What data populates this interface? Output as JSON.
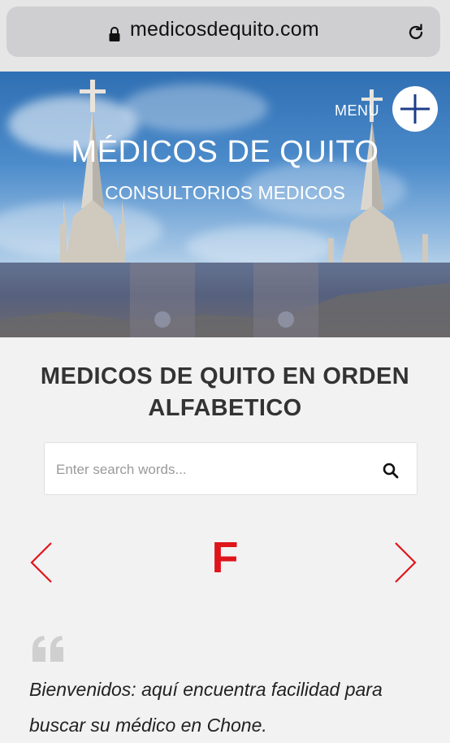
{
  "browser": {
    "url": "medicosdequito.com",
    "lock_icon": "lock-icon",
    "reload_icon": "reload-icon"
  },
  "header": {
    "title": "MÉDICOS DE QUITO",
    "subtitle": "CONSULTORIOS MEDICOS",
    "menu_label": "MENU",
    "menu_icon": "plus-icon"
  },
  "main": {
    "heading_line1": "MEDICOS DE QUITO EN ORDEN",
    "heading_line2": "ALFABETICO",
    "search": {
      "placeholder": "Enter search words...",
      "value": "",
      "icon": "search-icon"
    },
    "letter_nav": {
      "current_letter": "F",
      "prev_icon": "chevron-left-icon",
      "next_icon": "chevron-right-icon",
      "accent_color": "#e0141b"
    },
    "quote": {
      "icon": "quote-icon",
      "text": "Bienvenidos: aquí encuentra facilidad para buscar su médico en Chone."
    }
  }
}
